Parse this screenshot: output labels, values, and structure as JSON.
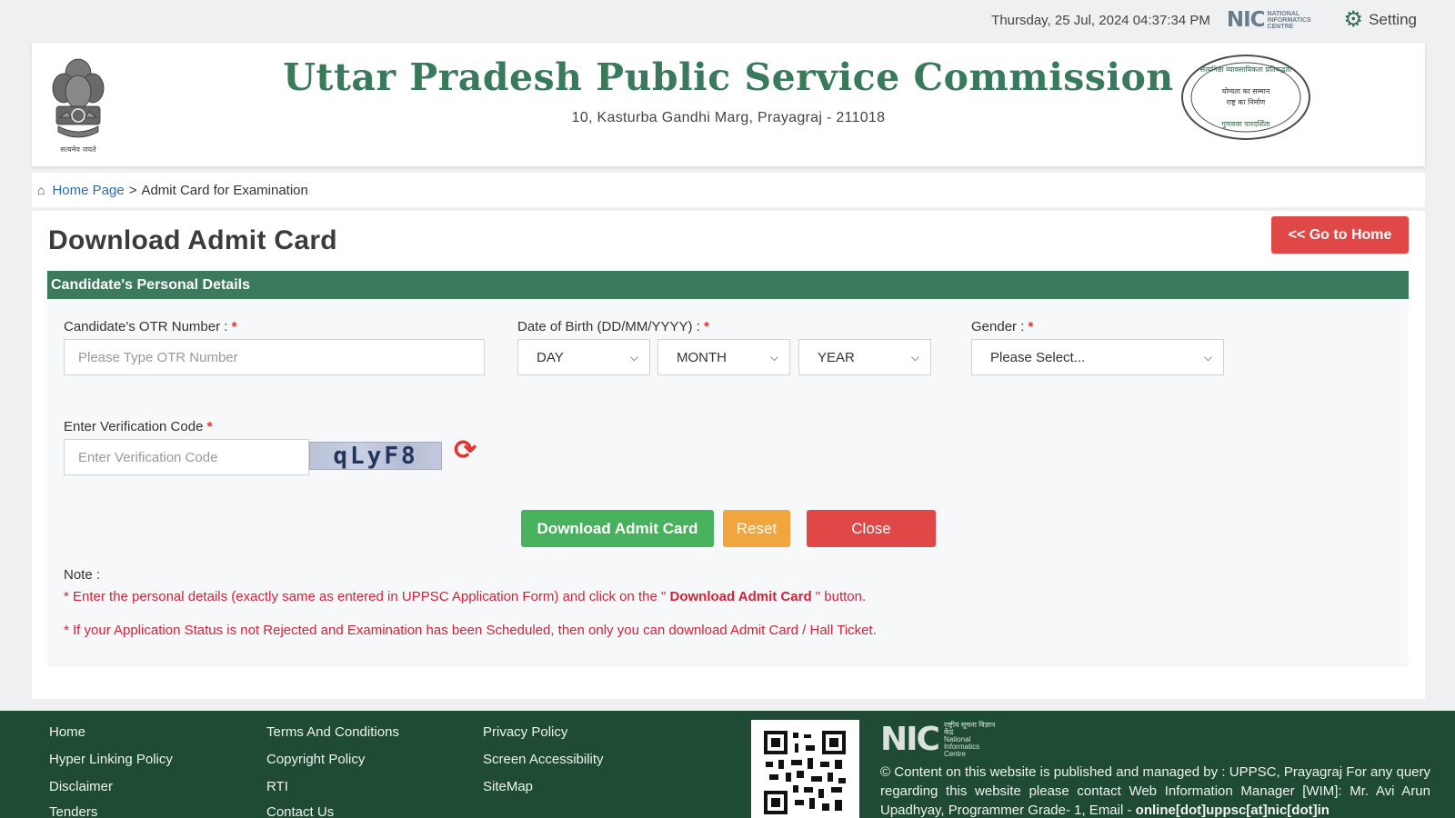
{
  "topbar": {
    "datetime": "Thursday, 25 Jul, 2024 04:37:34 PM",
    "nic_logo_word": "NIC",
    "nic_logo_sub": "NATIONAL INFORMATICS CENTRE",
    "setting_label": "Setting",
    "setting_icon": "gear-icon"
  },
  "header": {
    "title": "Uttar Pradesh Public Service Commission",
    "address": "10, Kasturba Gandhi Marg, Prayagraj - 211018",
    "emblem_caption": "सत्यमेव जयते",
    "seal_top": "सत्यनिष्ठा व्यावसायिकता प्रतिबद्धता",
    "seal_middle_1": "योग्यता का सम्मान",
    "seal_middle_2": "राष्ट्र का निर्माण",
    "seal_bottom": "गुणवत्ता पारदर्शिता"
  },
  "breadcrumb": {
    "home_label": "Home Page",
    "separator": ">",
    "current": "Admit Card for Examination"
  },
  "main": {
    "title": "Download Admit Card",
    "go_home_label": "<< Go to Home",
    "section_title": "Candidate's Personal Details",
    "otr_label": "Candidate's OTR Number :",
    "otr_placeholder": "Please Type OTR Number",
    "dob_label": "Date of Birth (DD/MM/YYYY) :",
    "dob_day": "DAY",
    "dob_month": "MONTH",
    "dob_year": "YEAR",
    "gender_label": "Gender :",
    "gender_value": "Please Select...",
    "required_mark": "*",
    "verification_label": "Enter Verification Code",
    "verification_placeholder": "Enter Verification Code",
    "captcha_text": "qLyF8",
    "download_label": "Download Admit Card",
    "reset_label": "Reset",
    "close_label": "Close",
    "note_label": "Note :",
    "note1_prefix": "* Enter the personal details (exactly same as entered in UPPSC Application Form) and click on the \"",
    "note1_bold": "Download Admit Card",
    "note1_suffix": "\" button.",
    "note2": "* If your Application Status is not Rejected and Examination has been Scheduled, then only you can download Admit Card / Hall Ticket."
  },
  "footer": {
    "col1": [
      "Home",
      "Hyper Linking Policy",
      "Disclaimer",
      "Tenders"
    ],
    "col2": [
      "Terms And Conditions",
      "Copyright Policy",
      "RTI",
      "Contact Us"
    ],
    "col3": [
      "Privacy Policy",
      "Screen Accessibility",
      "SiteMap"
    ],
    "nic_word": "NIC",
    "nic_sub_hindi": "राष्ट्रीय सूचना विज्ञान केंद्र",
    "nic_sub": "National Informatics Centre",
    "content_text": "© Content on this website is published and managed by : UPPSC, Prayagraj For any query regarding this website please contact Web Information Manager [WIM]: Mr. Avi Arun Upadhyay, Programmer Grade- 1, Email -",
    "email": "online[dot]uppsc[at]nic[dot]in"
  },
  "colors": {
    "brand_green": "#3a7a5c",
    "footer_green": "#1f4a33",
    "danger_red": "#e04848",
    "success_green": "#48b15d",
    "warning_orange": "#f0a53e",
    "note_red": "#d0243a"
  }
}
